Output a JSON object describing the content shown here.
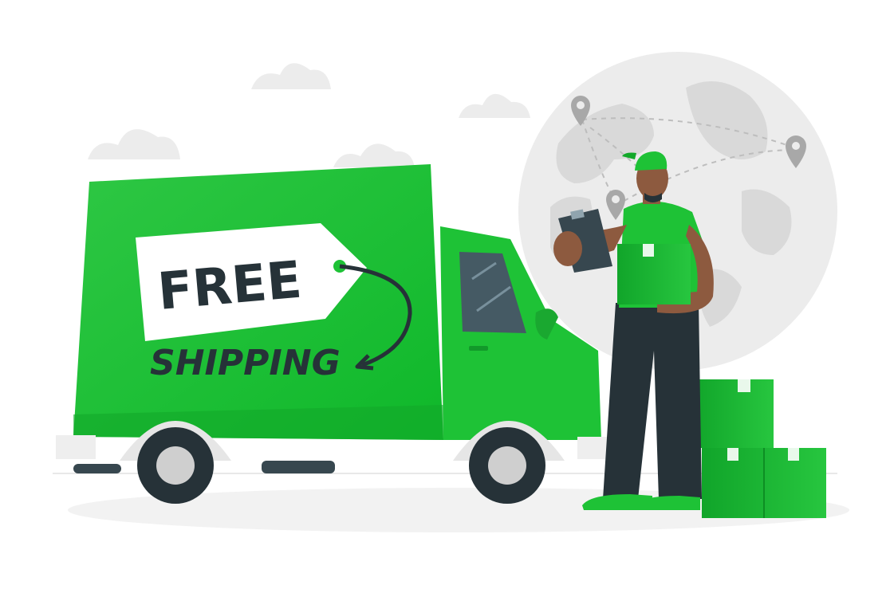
{
  "tag": {
    "free_label": "FREE",
    "shipping_label": "SHIPPING"
  },
  "colors": {
    "truck_green": "#1fc535",
    "truck_green_dark": "#13a82a",
    "tag_white": "#ffffff",
    "text_dark": "#263238",
    "globe_gray": "#ebebeb",
    "continent_gray": "#d6d6d6",
    "skin": "#8d5a3f",
    "pants": "#263238"
  },
  "icons": {
    "location_pin": "location-pin-icon",
    "cloud": "cloud-icon"
  }
}
